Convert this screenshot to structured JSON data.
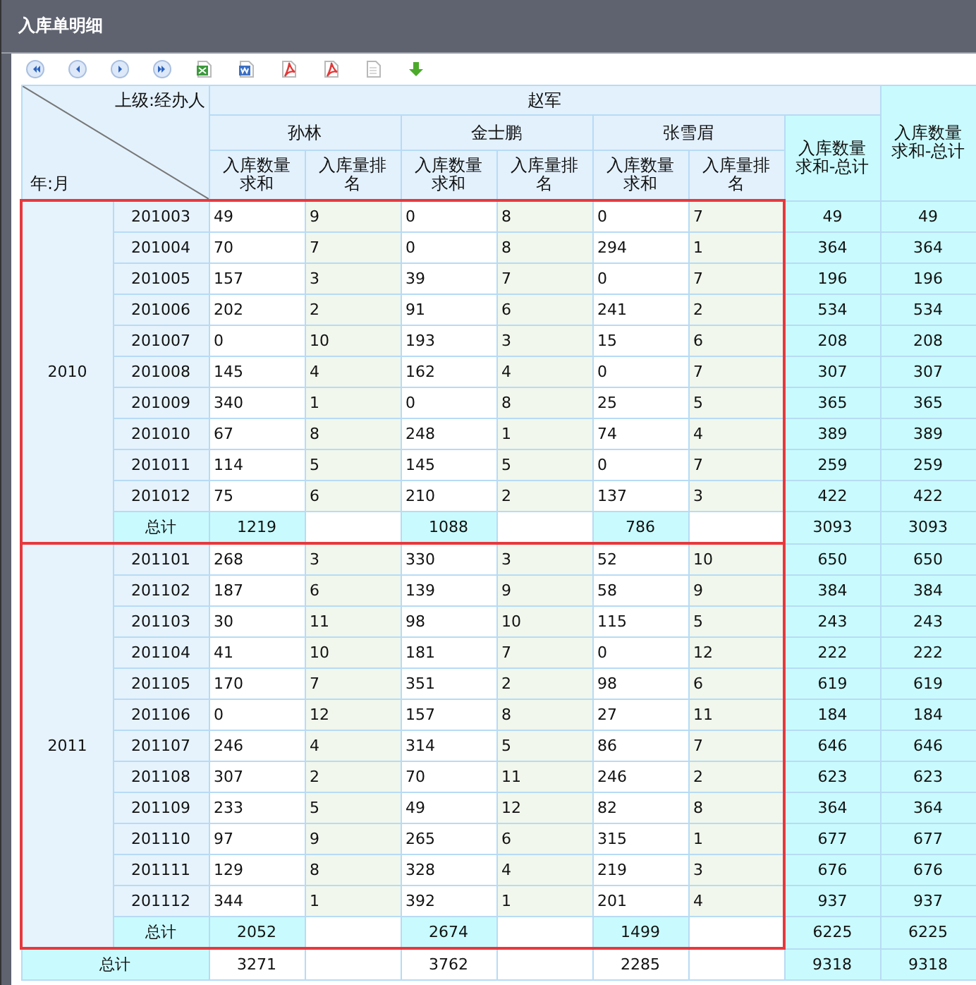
{
  "window": {
    "title": "入库单明细"
  },
  "toolbar": [
    {
      "kind": "first"
    },
    {
      "kind": "prev"
    },
    {
      "kind": "next"
    },
    {
      "kind": "last"
    },
    {
      "kind": "excel"
    },
    {
      "kind": "word"
    },
    {
      "kind": "pdf"
    },
    {
      "kind": "pdf"
    },
    {
      "kind": "text"
    },
    {
      "kind": "download"
    }
  ],
  "table": {
    "corner_top": "上级:经办人",
    "corner_bottom": "年:月",
    "supervisor": "赵军",
    "handlers": [
      {
        "name": "孙林",
        "columns": [
          "入库数量求和",
          "入库量排名"
        ]
      },
      {
        "name": "金士鹏",
        "columns": [
          "入库数量求和",
          "入库量排名"
        ]
      },
      {
        "name": "张雪眉",
        "columns": [
          "入库数量求和",
          "入库量排名"
        ]
      }
    ],
    "total_columns": [
      "入库数量求和-总计",
      "入库数量求和-总计"
    ],
    "groups": [
      {
        "year": "2010",
        "rows": [
          [
            "201003",
            "49",
            "9",
            "0",
            "8",
            "0",
            "7",
            "49",
            "49"
          ],
          [
            "201004",
            "70",
            "7",
            "0",
            "8",
            "294",
            "1",
            "364",
            "364"
          ],
          [
            "201005",
            "157",
            "3",
            "39",
            "7",
            "0",
            "7",
            "196",
            "196"
          ],
          [
            "201006",
            "202",
            "2",
            "91",
            "6",
            "241",
            "2",
            "534",
            "534"
          ],
          [
            "201007",
            "0",
            "10",
            "193",
            "3",
            "15",
            "6",
            "208",
            "208"
          ],
          [
            "201008",
            "145",
            "4",
            "162",
            "4",
            "0",
            "7",
            "307",
            "307"
          ],
          [
            "201009",
            "340",
            "1",
            "0",
            "8",
            "25",
            "5",
            "365",
            "365"
          ],
          [
            "201010",
            "67",
            "8",
            "248",
            "1",
            "74",
            "4",
            "389",
            "389"
          ],
          [
            "201011",
            "114",
            "5",
            "145",
            "5",
            "0",
            "7",
            "259",
            "259"
          ],
          [
            "201012",
            "75",
            "6",
            "210",
            "2",
            "137",
            "3",
            "422",
            "422"
          ]
        ],
        "subtotal": {
          "label": "总计",
          "values": [
            "1219",
            "1088",
            "786"
          ],
          "totals": [
            "3093",
            "3093"
          ]
        }
      },
      {
        "year": "2011",
        "rows": [
          [
            "201101",
            "268",
            "3",
            "330",
            "3",
            "52",
            "10",
            "650",
            "650"
          ],
          [
            "201102",
            "187",
            "6",
            "139",
            "9",
            "58",
            "9",
            "384",
            "384"
          ],
          [
            "201103",
            "30",
            "11",
            "98",
            "10",
            "115",
            "5",
            "243",
            "243"
          ],
          [
            "201104",
            "41",
            "10",
            "181",
            "7",
            "0",
            "12",
            "222",
            "222"
          ],
          [
            "201105",
            "170",
            "7",
            "351",
            "2",
            "98",
            "6",
            "619",
            "619"
          ],
          [
            "201106",
            "0",
            "12",
            "157",
            "8",
            "27",
            "11",
            "184",
            "184"
          ],
          [
            "201107",
            "246",
            "4",
            "314",
            "5",
            "86",
            "7",
            "646",
            "646"
          ],
          [
            "201108",
            "307",
            "2",
            "70",
            "11",
            "246",
            "2",
            "623",
            "623"
          ],
          [
            "201109",
            "233",
            "5",
            "49",
            "12",
            "82",
            "8",
            "364",
            "364"
          ],
          [
            "201110",
            "97",
            "9",
            "265",
            "6",
            "315",
            "1",
            "677",
            "677"
          ],
          [
            "201111",
            "129",
            "8",
            "328",
            "4",
            "219",
            "3",
            "676",
            "676"
          ],
          [
            "201112",
            "344",
            "1",
            "392",
            "1",
            "201",
            "4",
            "937",
            "937"
          ]
        ],
        "subtotal": {
          "label": "总计",
          "values": [
            "2052",
            "2674",
            "1499"
          ],
          "totals": [
            "6225",
            "6225"
          ]
        }
      }
    ],
    "grand_total": {
      "label": "总计",
      "values": [
        "3271",
        "3762",
        "2285"
      ],
      "totals": [
        "9318",
        "9318"
      ]
    }
  }
}
